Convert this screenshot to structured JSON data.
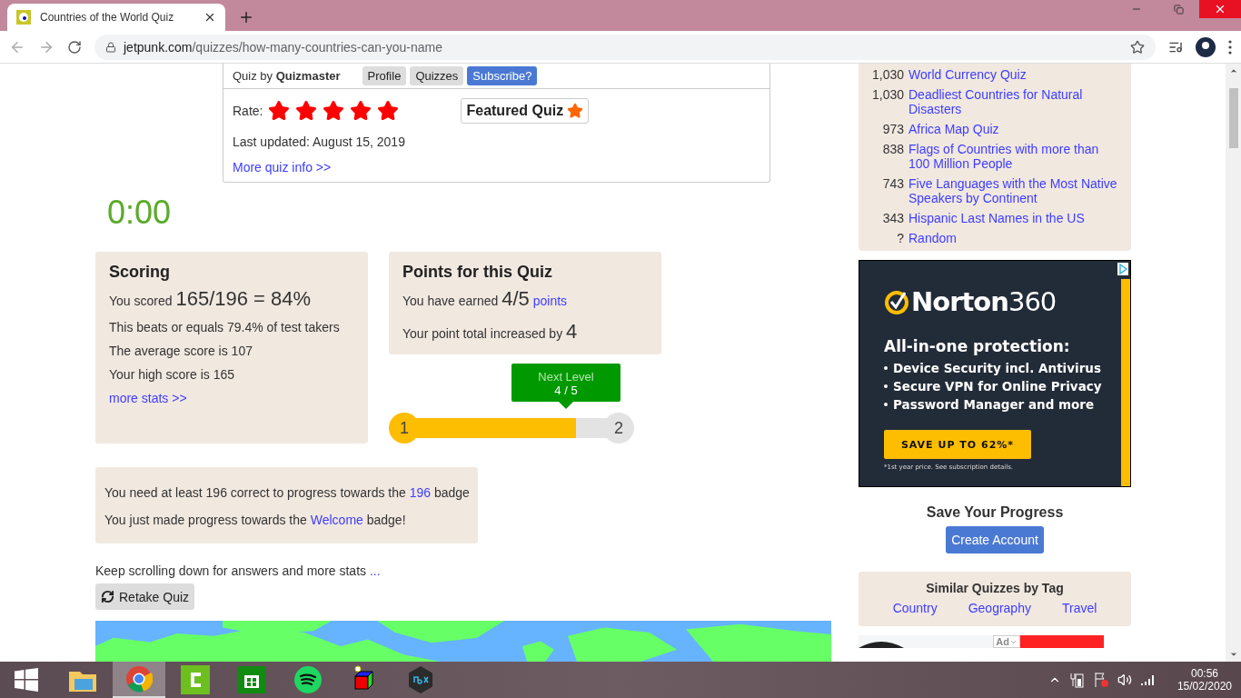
{
  "browser": {
    "tab_title": "Countries of the World Quiz",
    "url_domain": "jetpunk.com",
    "url_path": "/quizzes/how-many-countries-can-you-name"
  },
  "quiz_info": {
    "by_label": "Quiz by",
    "author": "Quizmaster",
    "buttons": [
      {
        "label": "Profile",
        "kind": "plain"
      },
      {
        "label": "Quizzes",
        "kind": "plain"
      },
      {
        "label": "Subscribe?",
        "kind": "primary"
      }
    ],
    "rate_label": "Rate:",
    "stars": 5,
    "featured": "Featured Quiz",
    "last_updated": "Last updated: August 15, 2019",
    "more_info": "More quiz info >>"
  },
  "timer": "0:00",
  "scoring": {
    "title": "Scoring",
    "score_prefix": "You scored",
    "score": "165/196 = 84%",
    "lines": [
      "This beats or equals 79.4% of test takers",
      "The average score is 107",
      "Your high score is 165"
    ],
    "more_stats": "more stats >>"
  },
  "points": {
    "title": "Points for this Quiz",
    "earned_prefix": "You have earned",
    "earned": "4/5",
    "points_link": "points",
    "increase_prefix": "Your point total increased by",
    "increase": "4"
  },
  "level": {
    "tooltip_title": "Next Level",
    "tooltip_value": "4 / 5",
    "from": "1",
    "to": "2",
    "level": 0.8
  },
  "badges": [
    {
      "prefix": "You need at least 196 correct to progress towards the",
      "link": "196",
      "suffix": "badge"
    },
    {
      "prefix": "You just made progress towards the",
      "link": "Welcome",
      "suffix": "badge!"
    }
  ],
  "keep_scrolling": {
    "text": "Keep scrolling down for answers and more stats",
    "link": "..."
  },
  "retake": "Retake Quiz",
  "popular": [
    {
      "count": "1,030",
      "title": "World Currency Quiz"
    },
    {
      "count": "1,030",
      "title": "Deadliest Countries for Natural Disasters"
    },
    {
      "count": "973",
      "title": "Africa Map Quiz"
    },
    {
      "count": "838",
      "title": "Flags of Countries with more than 100 Million People"
    },
    {
      "count": "743",
      "title": "Five Languages with the Most Native Speakers by Continent"
    },
    {
      "count": "343",
      "title": "Hispanic Last Names in the US"
    },
    {
      "count": "?",
      "title": "Random"
    }
  ],
  "ad": {
    "brand": "Norton",
    "brand_number": "360",
    "headline": "All-in-one protection:",
    "bullets": [
      "Device Security incl. Antivirus",
      "Secure VPN for Online Privacy",
      "Password Manager and more"
    ],
    "cta": "SAVE UP TO 62%*",
    "footnote": "*1st year price. See subscription details."
  },
  "save_progress": {
    "title": "Save Your Progress",
    "button": "Create Account"
  },
  "similar": {
    "title": "Similar Quizzes by Tag",
    "tags": [
      "Country",
      "Geography",
      "Travel"
    ]
  },
  "bottom_ad": {
    "label": "Ad"
  },
  "taskbar": {
    "apps": [
      {
        "kind": "explorer",
        "selected": false
      },
      {
        "kind": "chrome",
        "selected": true
      },
      {
        "kind": "camtasia",
        "selected": false
      },
      {
        "kind": "store",
        "selected": false
      },
      {
        "kind": "spotify",
        "selected": false
      },
      {
        "kind": "cube",
        "selected": false
      },
      {
        "kind": "nox",
        "selected": false
      }
    ],
    "time": "00:56",
    "date": "15/02/2020"
  }
}
